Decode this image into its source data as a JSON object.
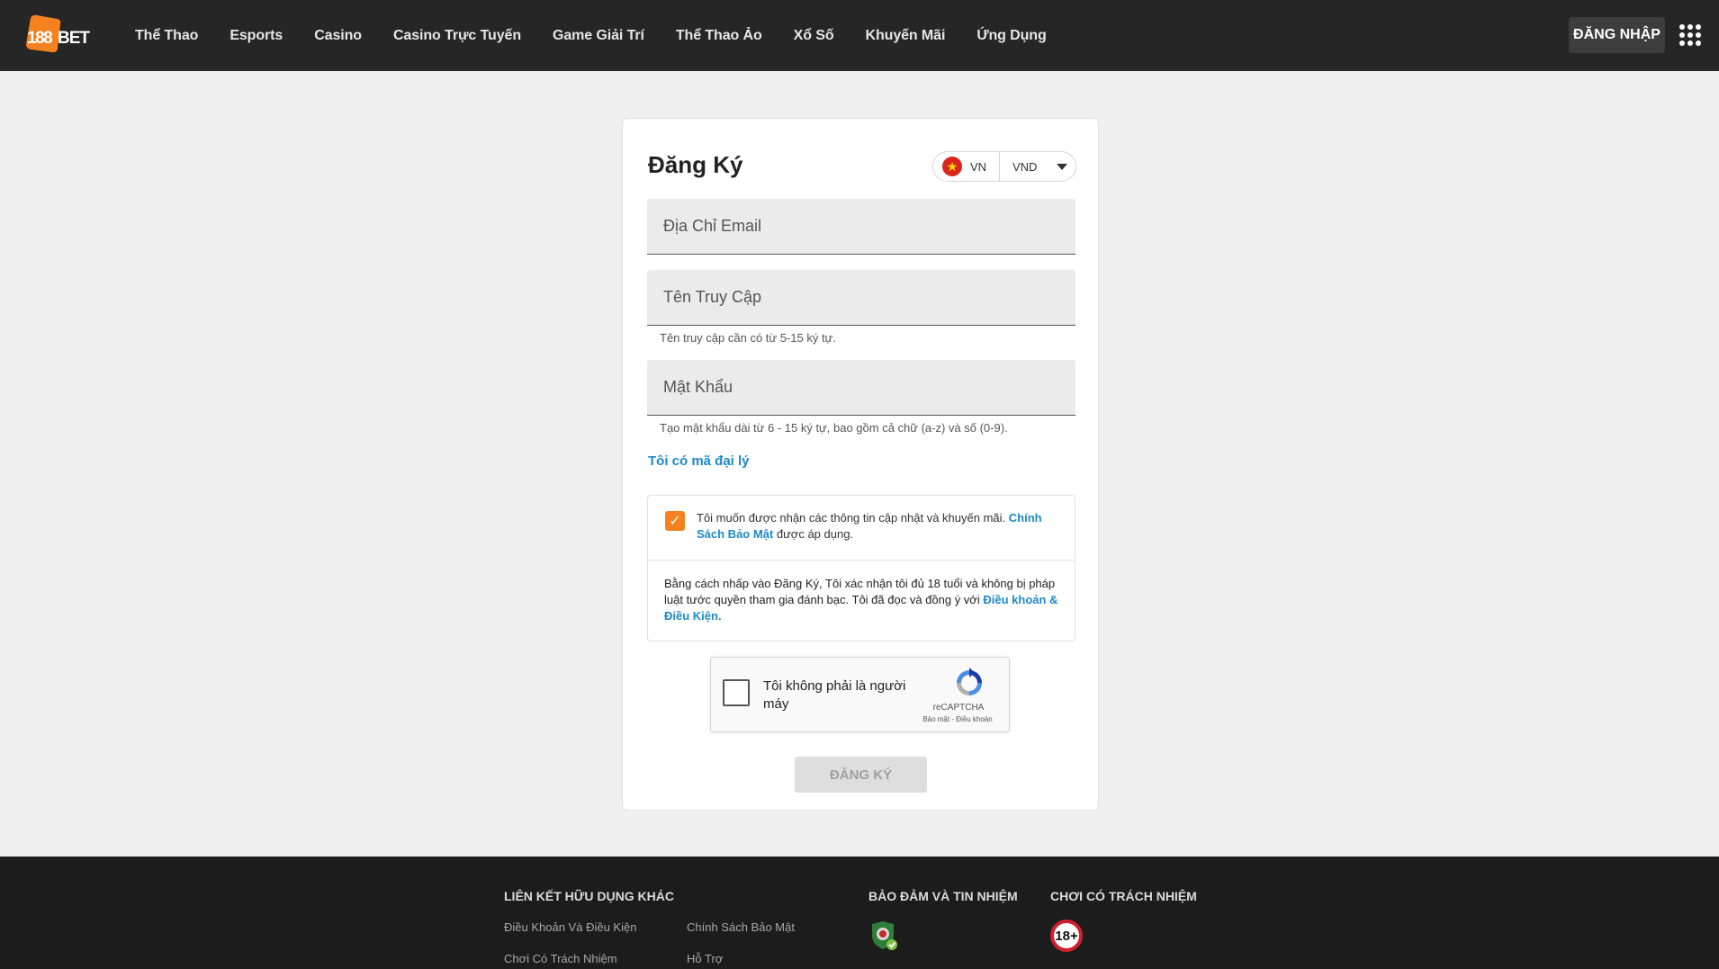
{
  "brand": {
    "logo_text": "188BET",
    "accent": "#f5811f"
  },
  "nav": {
    "items": [
      "Thể Thao",
      "Esports",
      "Casino",
      "Casino Trực Tuyến",
      "Game Giải Trí",
      "Thể Thao Ảo",
      "Xổ Số",
      "Khuyến Mãi",
      "Ứng Dụng"
    ],
    "login_label": "ĐĂNG NHẬP",
    "apps_icon": "grid-menu-icon"
  },
  "register": {
    "title": "Đăng Ký",
    "country": "VN",
    "currency": "VND",
    "email_placeholder": "Địa Chỉ Email",
    "username_placeholder": "Tên Truy Cập",
    "username_hint": "Tên truy cập cần có từ 5-15 ký tự.",
    "password_placeholder": "Mật Khẩu",
    "password_hint": "Tạo mật khẩu dài từ 6 - 15 ký tự, bao gồm cả chữ (a-z) và số (0-9).",
    "agent_link": "Tôi có mã đại lý",
    "marketing_checked": true,
    "marketing_text": "Tôi muốn được nhận các thông tin cập nhật và khuyến mãi.",
    "privacy_link": "Chính Sách Bảo Mật",
    "marketing_suffix": "được áp dụng.",
    "terms_text": "Bằng cách nhấp vào Đăng Ký, Tôi xác nhận tôi đủ 18 tuổi và không bị pháp luật tước quyền tham gia đánh bạc. Tôi đã đọc và đồng ý với",
    "terms_link": "Điều khoản & Điều Kiện.",
    "submit_label": "ĐĂNG KÝ"
  },
  "recaptcha": {
    "label": "Tôi không phải là người máy",
    "brand": "reCAPTCHA",
    "links": "Bảo mật - Điều khoản"
  },
  "footer": {
    "useful_links_heading": "LIÊN KẾT HỮU DỤNG KHÁC",
    "links_col1": [
      "Điều Khoản Và Điều Kiện",
      "Chơi Có Trách Nhiệm"
    ],
    "links_col2": [
      "Chính Sách Bảo Mật",
      "Hỗ Trợ"
    ],
    "trust_heading": "BẢO ĐẢM VÀ TIN NHIỆM",
    "responsible_heading": "CHƠI CÓ TRÁCH NHIỆM",
    "age_badge": "18+"
  }
}
